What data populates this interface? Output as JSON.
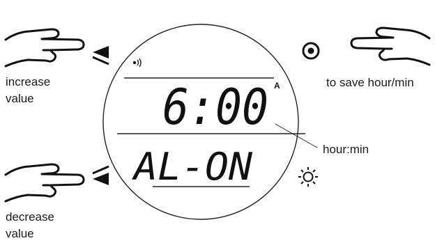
{
  "watch": {
    "time_display": "6:00",
    "am_pm_indicator": "A",
    "mode_display": "AL-ON",
    "alarm_icon": "sound-icon",
    "light_icon": "sun-icon",
    "mode_button_icon": "circle-dot-icon"
  },
  "callouts": {
    "increase_line1": "increase",
    "increase_line2": "value",
    "decrease_line1": "decrease",
    "decrease_line2": "value",
    "save": "to save hour/min",
    "hour_min": "hour:min"
  },
  "colors": {
    "ink": "#1a1a1a",
    "background": "#ffffff"
  }
}
